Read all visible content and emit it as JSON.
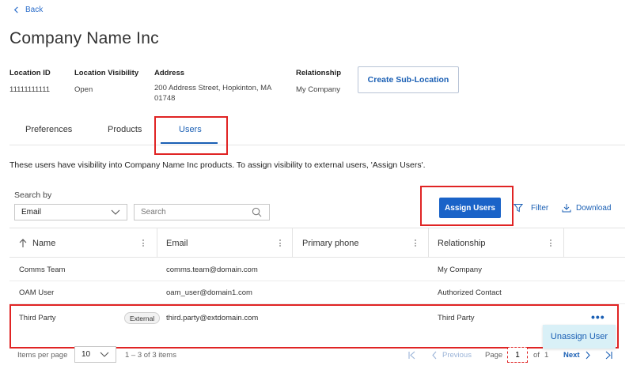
{
  "nav": {
    "back_label": "Back"
  },
  "page": {
    "title": "Company Name Inc"
  },
  "info": {
    "location_id_label": "Location ID",
    "location_id_value": "11111111111",
    "visibility_label": "Location Visibility",
    "visibility_value": "Open",
    "address_label": "Address",
    "address_line1": "200 Address Street, Hopkinton, MA",
    "address_line2": "01748",
    "relationship_label": "Relationship",
    "relationship_value": "My Company",
    "create_sublocation_label": "Create Sub-Location"
  },
  "tabs": [
    {
      "label": "Preferences"
    },
    {
      "label": "Products"
    },
    {
      "label": "Users"
    }
  ],
  "description": "These users have visibility into Company Name Inc products. To assign visibility to external users, 'Assign Users'.",
  "search": {
    "search_by_label": "Search by",
    "field_value": "Email",
    "placeholder": "Search"
  },
  "toolbar": {
    "assign_users_label": "Assign Users",
    "filter_label": "Filter",
    "download_label": "Download"
  },
  "table": {
    "headers": {
      "name": "Name",
      "email": "Email",
      "phone": "Primary phone",
      "relationship": "Relationship"
    },
    "rows": [
      {
        "name": "Comms Team",
        "email": "comms.team@domain.com",
        "phone": "",
        "relationship": "My Company",
        "badge": ""
      },
      {
        "name": "OAM User",
        "email": "oam_user@domain1.com",
        "phone": "",
        "relationship": "Authorized Contact",
        "badge": ""
      },
      {
        "name": "Third Party",
        "email": "third.party@extdomain.com",
        "phone": "",
        "relationship": "Third Party",
        "badge": "External"
      }
    ],
    "row_menu": {
      "dots": "•••",
      "unassign_label": "Unassign User"
    }
  },
  "footer": {
    "items_per_page_label": "Items per page",
    "items_per_page_value": "10",
    "range_text": "1 – 3 of 3 items",
    "previous_label": "Previous",
    "page_label": "Page",
    "page_value": "1",
    "of_label": "of",
    "total_pages": "1",
    "next_label": "Next"
  },
  "colors": {
    "accent": "#1a5fb4",
    "primary_button": "#1a63c8",
    "highlight": "#e02424",
    "popup_bg": "#d9f0f7"
  }
}
